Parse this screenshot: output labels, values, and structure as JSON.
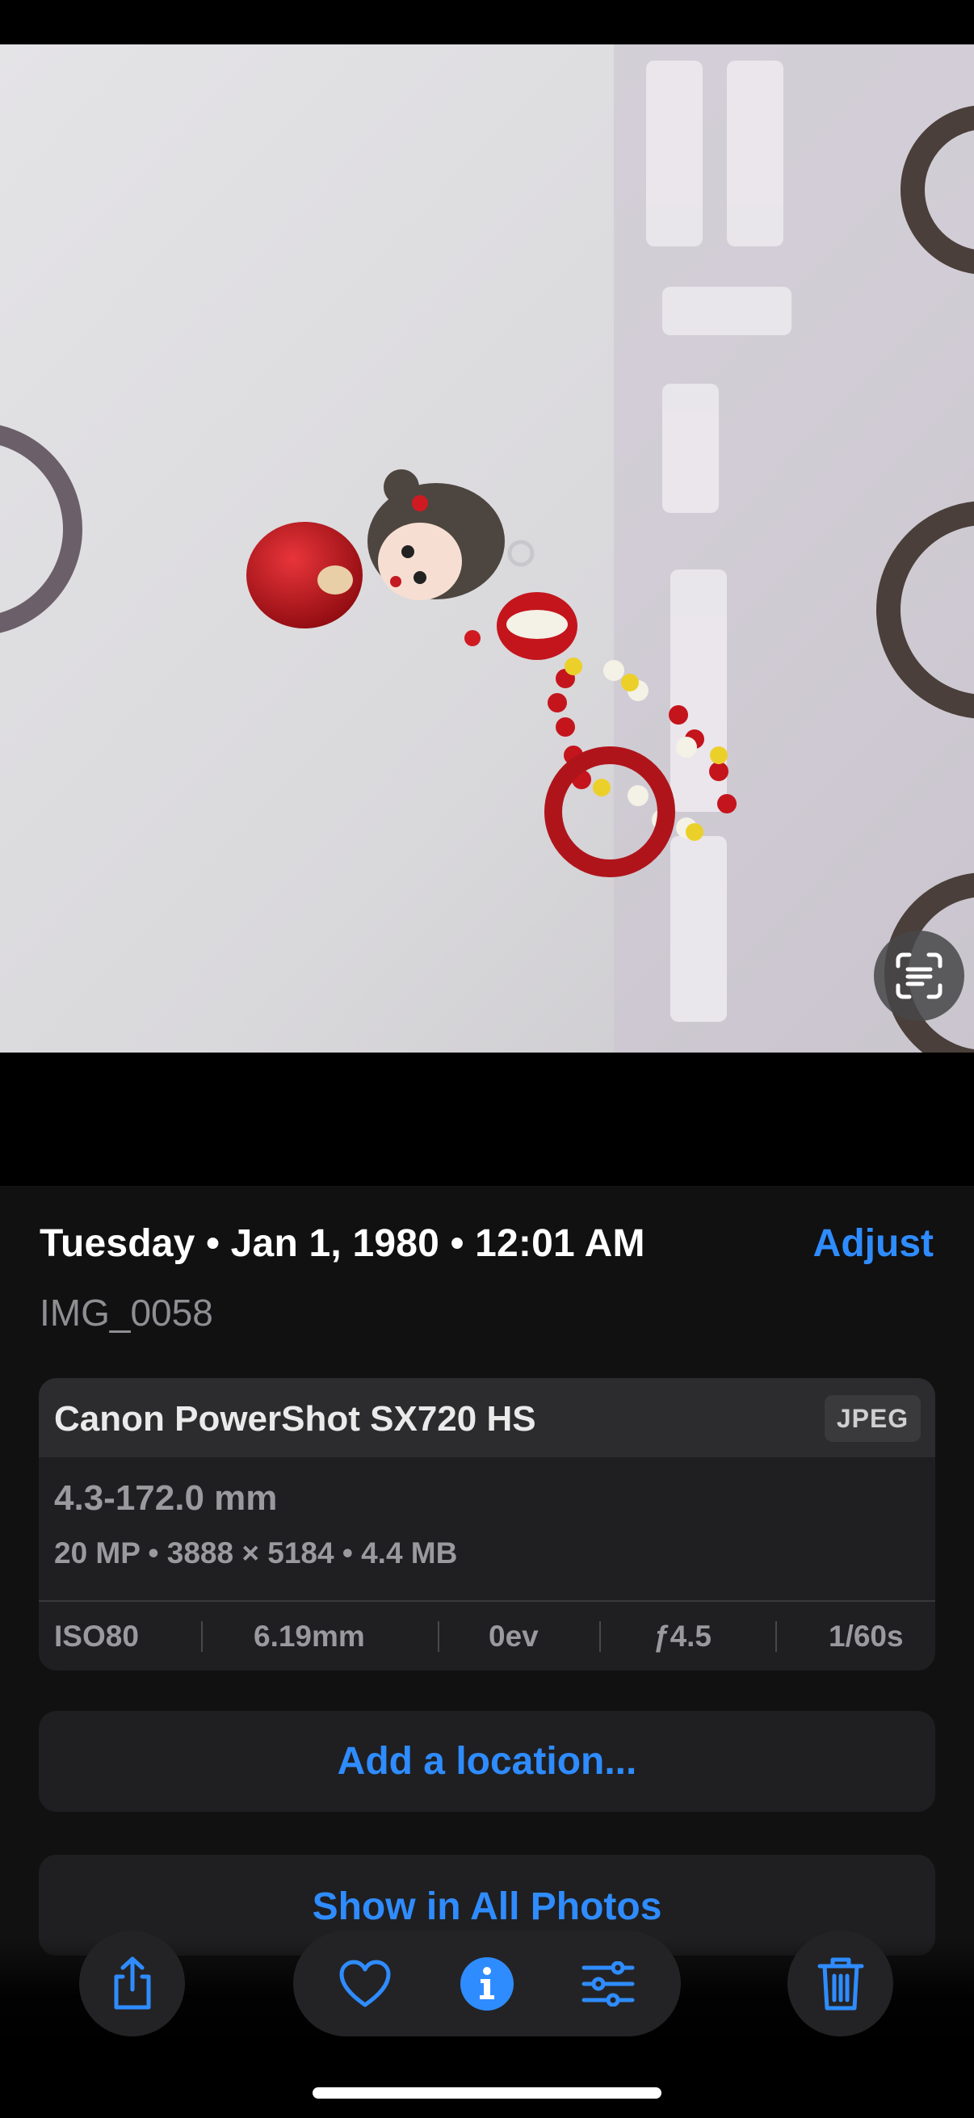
{
  "photo": {
    "description_icon": "live-text-icon"
  },
  "info": {
    "date_line": "Tuesday • Jan 1, 1980 • 12:01 AM",
    "adjust_label": "Adjust",
    "filename": "IMG_0058"
  },
  "metadata": {
    "camera": "Canon PowerShot SX720 HS",
    "format": "JPEG",
    "lens": "4.3-172.0 mm",
    "specs": "20 MP • 3888 × 5184 • 4.4 MB",
    "exif": {
      "iso": "ISO80",
      "focal": "6.19mm",
      "ev": "0ev",
      "aperture": "ƒ4.5",
      "shutter": "1/60s"
    }
  },
  "actions": {
    "add_location": "Add a location...",
    "show_all_photos": "Show in All Photos"
  },
  "toolbar": {
    "share_icon": "share-icon",
    "favorite_icon": "heart-icon",
    "info_icon": "info-icon",
    "adjust_icon": "sliders-icon",
    "delete_icon": "trash-icon"
  },
  "colors": {
    "accent": "#2f8cff",
    "sheet_bg": "#111112",
    "card_bg": "#1f1f21"
  }
}
